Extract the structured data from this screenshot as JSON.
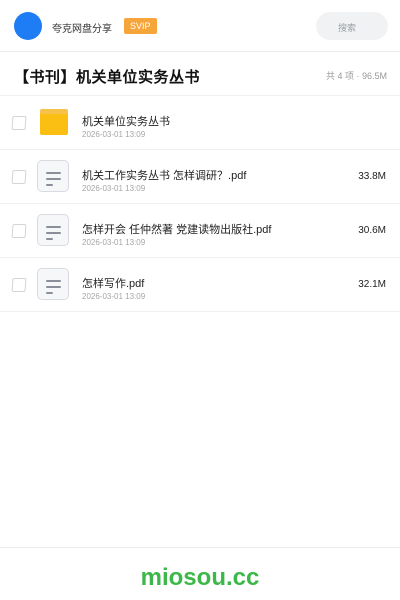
{
  "header": {
    "app_name": "夸克网盘分享",
    "badge": "SVIP",
    "search_placeholder": "搜索"
  },
  "folder_title": "【书刊】机关单位实务丛书",
  "summary": "共 4 项 · 96.5M",
  "files": [
    {
      "name": "机关单位实务丛书",
      "date": "2026-03-01 13:09",
      "size": "",
      "icon": "folder-icon"
    },
    {
      "name": "机关工作实务丛书 怎样调研？.pdf",
      "date": "2026-03-01 13:09",
      "size": "33.8M",
      "icon": "pdf-file-icon"
    },
    {
      "name": "怎样开会 任仲然著 党建读物出版社.pdf",
      "date": "2026-03-01 13:09",
      "size": "30.6M",
      "icon": "pdf-file-icon"
    },
    {
      "name": "怎样写作.pdf",
      "date": "2026-03-01 13:09",
      "size": "32.1M",
      "icon": "pdf-file-icon"
    }
  ],
  "watermark": "miosou.cc",
  "colors": {
    "accent": "#1e7cf5",
    "badge": "#f5a53a",
    "folder": "#fbbf13",
    "watermark": "#3cb848"
  }
}
